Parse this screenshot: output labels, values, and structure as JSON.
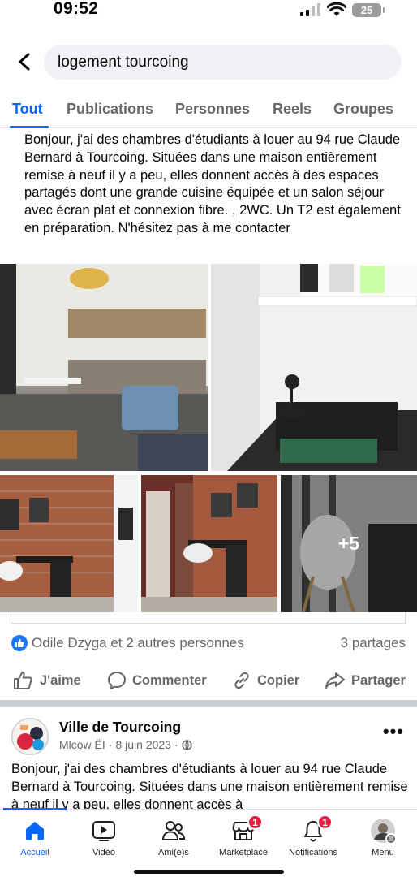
{
  "status_bar": {
    "time": "09:52",
    "battery": "25"
  },
  "search": {
    "query": "logement tourcoing"
  },
  "tabs": [
    {
      "label": "Tout",
      "active": true
    },
    {
      "label": "Publications",
      "active": false
    },
    {
      "label": "Personnes",
      "active": false
    },
    {
      "label": "Reels",
      "active": false
    },
    {
      "label": "Groupes",
      "active": false
    }
  ],
  "post1": {
    "text": "Bonjour, j'ai des chambres d'étudiants à louer au 94 rue Claude Bernard à Tourcoing. Situées dans une maison entièrement remise à neuf il y a peu, elles donnent accès à des espaces partagés dont une grande cuisine équipée et un salon séjour avec écran plat et connexion fibre. , 2WC. Un T2 est également en préparation. N'hésitez pas à me contacter",
    "more_photos": "+5",
    "reactions_text": "Odile Dzyga et 2 autres personnes",
    "shares_text": "3 partages",
    "actions": {
      "like": "J'aime",
      "comment": "Commenter",
      "copy": "Copier",
      "share": "Partager"
    }
  },
  "post2": {
    "author": "Ville de Tourcoing",
    "meta_user": "Mlcow ËI",
    "meta_date": "8 juin 2023",
    "text": "Bonjour, j'ai des chambres d'étudiants à louer au 94 rue Claude Bernard à Tourcoing. Situées dans une maison entièrement remise à neuf il y a peu, elles donnent accès à"
  },
  "bottom_nav": {
    "home": "Accueil",
    "video": "Vidéo",
    "friends": "Ami(e)s",
    "marketplace": "Marketplace",
    "marketplace_badge": "1",
    "notifications": "Notifications",
    "notifications_badge": "1",
    "menu": "Menu"
  },
  "colors": {
    "accent": "#0866ff",
    "badge": "#e41e3f",
    "muted": "#65676b"
  }
}
